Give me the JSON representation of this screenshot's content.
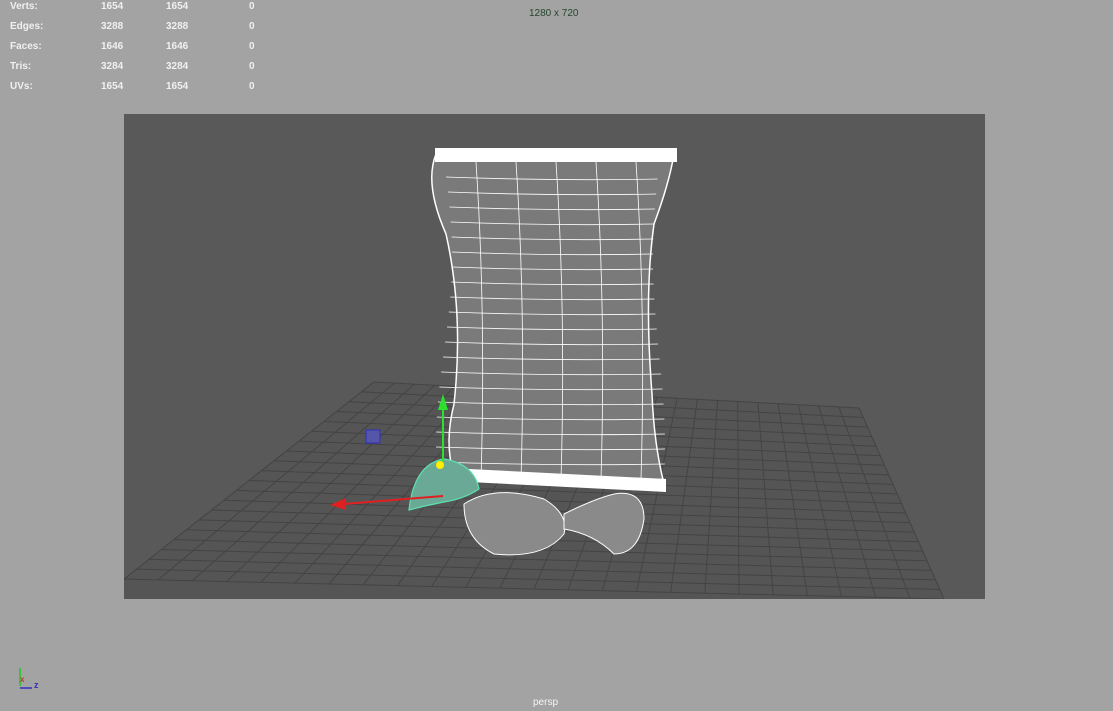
{
  "hud": {
    "rows": [
      {
        "label": "Verts:",
        "a": "1654",
        "b": "1654",
        "c": "0"
      },
      {
        "label": "Edges:",
        "a": "3288",
        "b": "3288",
        "c": "0"
      },
      {
        "label": "Faces:",
        "a": "1646",
        "b": "1646",
        "c": "0"
      },
      {
        "label": "Tris:",
        "a": "3284",
        "b": "3284",
        "c": "0"
      },
      {
        "label": "UVs:",
        "a": "1654",
        "b": "1654",
        "c": "0"
      }
    ]
  },
  "resolution": "1280 x 720",
  "camera": "persp",
  "axis": {
    "x": "x",
    "z": "z"
  },
  "colors": {
    "background": "#a3a3a3",
    "gate": "#595959",
    "selection": "#5fe0b0"
  }
}
